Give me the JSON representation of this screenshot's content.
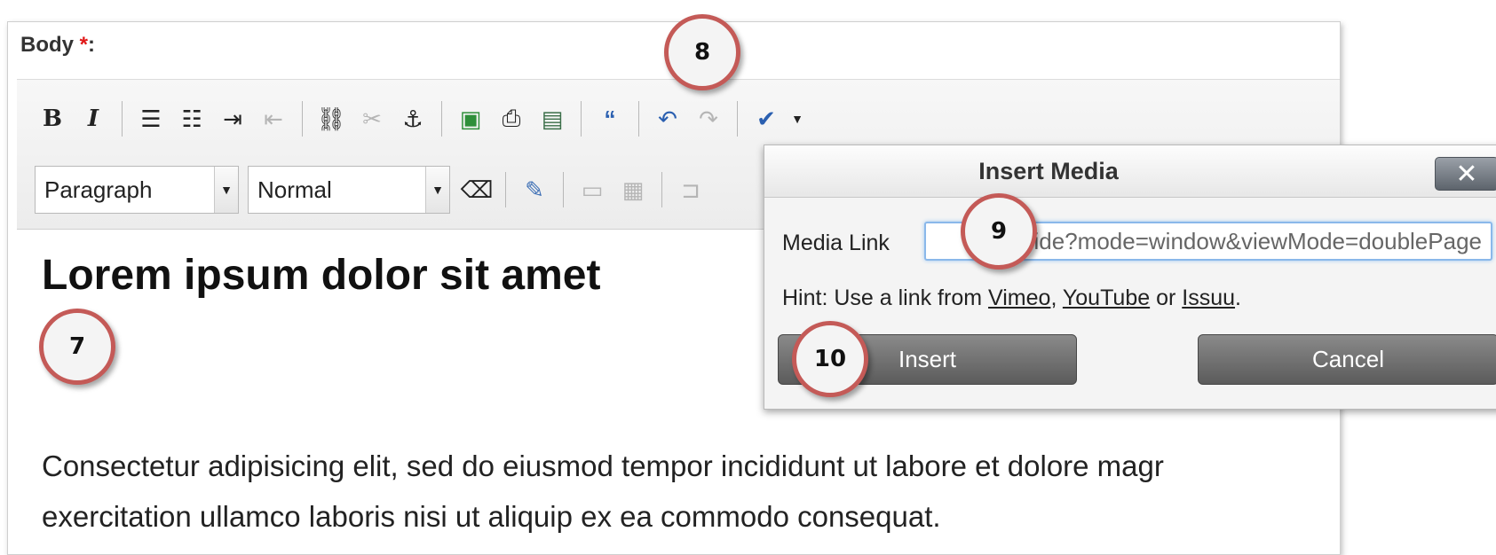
{
  "editor": {
    "body_label": "Body ",
    "required_mark": "*",
    "label_colon": ":",
    "toolbar": {
      "row1_icons": [
        "bold-icon",
        "italic-icon",
        "bulleted-list-icon",
        "numbered-list-icon",
        "indent-icon",
        "outdent-icon",
        "link-icon",
        "unlink-icon",
        "anchor-icon",
        "image-icon",
        "insert-link-icon",
        "insert-media-icon",
        "blockquote-icon",
        "undo-icon",
        "redo-icon",
        "spellcheck-icon"
      ],
      "format_select": "Paragraph",
      "style_select": "Normal",
      "row2_icons": [
        "eraser-icon",
        "edit-icon",
        "table-row-icon",
        "table-column-icon",
        "table-merge-icon"
      ]
    },
    "heading": "Lorem ipsum dolor sit amet",
    "paragraph_line1": "Consectetur adipisicing elit, sed do eiusmod tempor incididunt ut labore et dolore magr",
    "paragraph_line2": "exercitation ullamco laboris nisi ut aliquip ex ea commodo consequat."
  },
  "dialog": {
    "title": "Insert Media",
    "close": "✕",
    "media_link_label": "Media Link",
    "media_link_value": "enguide?mode=window&viewMode=doublePage",
    "hint_prefix": "Hint: Use a link from ",
    "hint_vimeo": "Vimeo",
    "hint_sep1": ", ",
    "hint_youtube": "YouTube",
    "hint_sep2": " or ",
    "hint_issuu": "Issuu",
    "hint_end": ".",
    "insert_label": "Insert",
    "cancel_label": "Cancel"
  },
  "callouts": [
    "7",
    "8",
    "9",
    "10"
  ],
  "colors": {
    "callout_ring": "#c45a57",
    "required": "#e01818",
    "input_focus": "#8ab8ea"
  }
}
